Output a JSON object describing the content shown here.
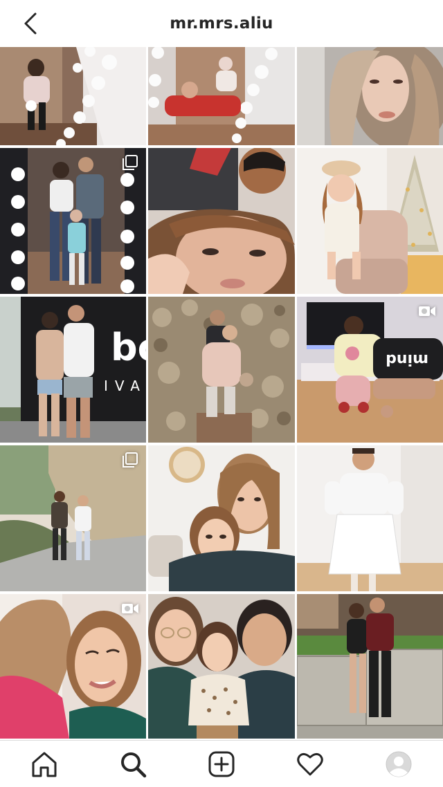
{
  "header": {
    "username": "mr.mrs.aliu",
    "back_icon": "chevron-left-icon"
  },
  "grid": {
    "posts": [
      {
        "name": "post-1",
        "badge": ""
      },
      {
        "name": "post-2",
        "badge": ""
      },
      {
        "name": "post-3",
        "badge": ""
      },
      {
        "name": "post-4",
        "badge": "carousel"
      },
      {
        "name": "post-5",
        "badge": ""
      },
      {
        "name": "post-6",
        "badge": ""
      },
      {
        "name": "post-7",
        "badge": "",
        "overlay_text": "bc\nIVA"
      },
      {
        "name": "post-8",
        "badge": ""
      },
      {
        "name": "post-9",
        "badge": "video",
        "overlay_text": "mind"
      },
      {
        "name": "post-10",
        "badge": "carousel"
      },
      {
        "name": "post-11",
        "badge": ""
      },
      {
        "name": "post-12",
        "badge": ""
      },
      {
        "name": "post-13",
        "badge": "video"
      },
      {
        "name": "post-14",
        "badge": ""
      },
      {
        "name": "post-15",
        "badge": ""
      }
    ]
  },
  "tabbar": {
    "items": [
      "home-icon",
      "search-icon",
      "new-post-icon",
      "activity-heart-icon",
      "profile-avatar"
    ],
    "active": "search-icon"
  },
  "colors": {
    "text": "#262626",
    "border": "#dbdbdb",
    "background": "#ffffff"
  }
}
